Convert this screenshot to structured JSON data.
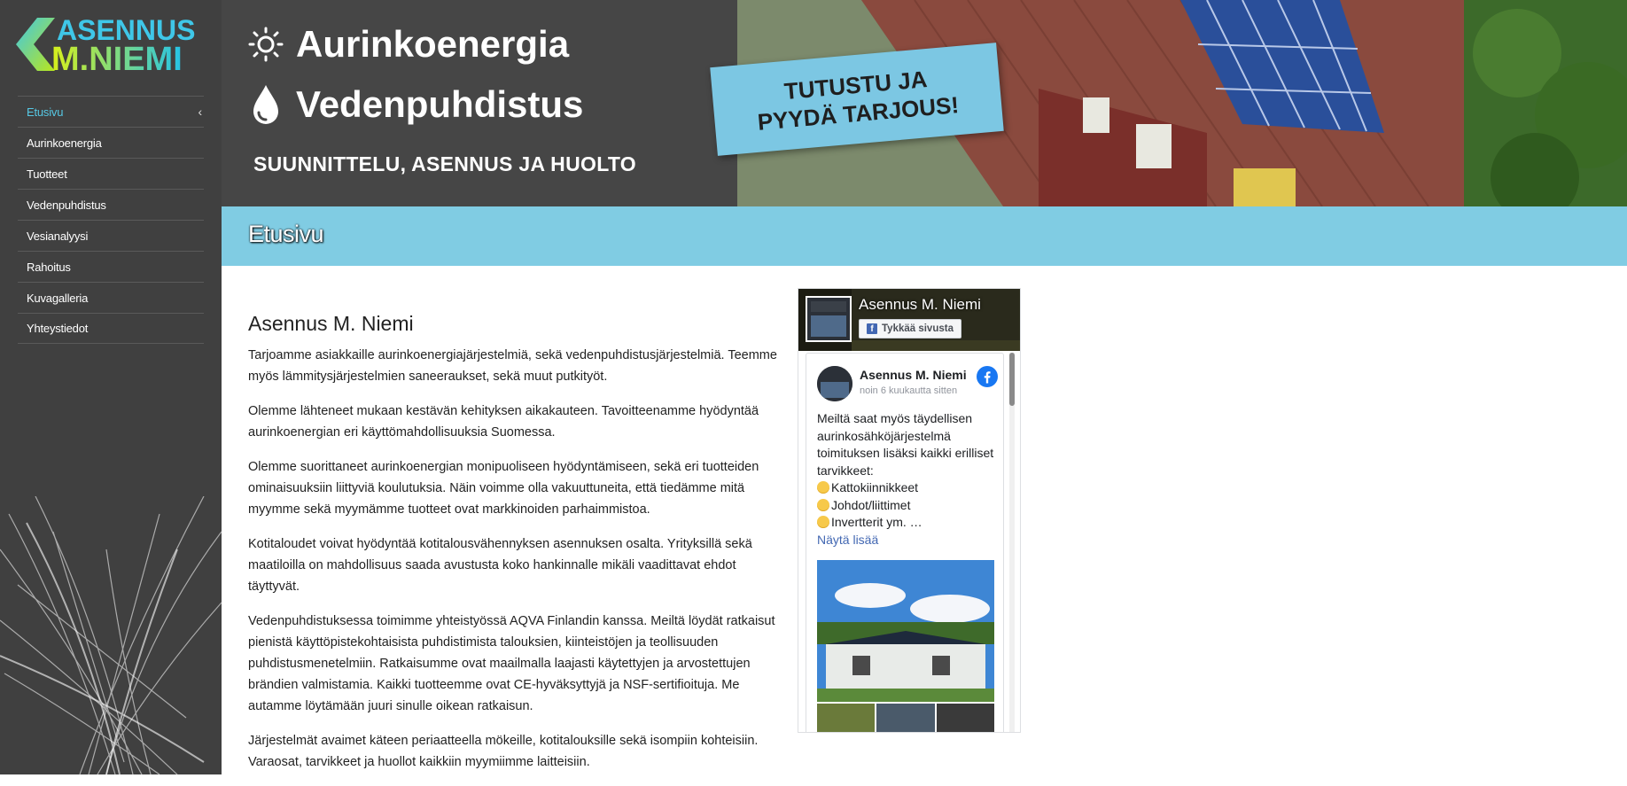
{
  "logo": {
    "line1": "ASENNUS",
    "line2": "M.NIEMI"
  },
  "nav": {
    "items": [
      {
        "label": "Etusivu",
        "active": true
      },
      {
        "label": "Aurinkoenergia"
      },
      {
        "label": "Tuotteet"
      },
      {
        "label": "Vedenpuhdistus"
      },
      {
        "label": "Vesianalyysi"
      },
      {
        "label": "Rahoitus"
      },
      {
        "label": "Kuvagalleria"
      },
      {
        "label": "Yhteystiedot"
      }
    ],
    "active_chevron": "‹"
  },
  "banner": {
    "line1": "Aurinkoenergia",
    "line2": "Vedenpuhdistus",
    "subtitle": "SUUNNITTELU, ASENNUS JA HUOLTO",
    "cta_line1": "TUTUSTU JA",
    "cta_line2": "PYYDÄ TARJOUS!",
    "icon1": "sun-icon",
    "icon2": "water-drop-icon"
  },
  "page": {
    "title": "Etusivu"
  },
  "content": {
    "heading": "Asennus M. Niemi",
    "paragraphs": [
      "Tarjoamme asiakkaille aurinkoenergiajärjestelmiä, sekä vedenpuhdistusjärjestelmiä. Teemme myös lämmitysjärjestelmien saneeraukset, sekä muut putkityöt.",
      "Olemme lähteneet mukaan kestävän kehityksen aikakauteen. Tavoitteenamme hyödyntää aurinkoenergian eri käyttömahdollisuuksia Suomessa.",
      "Olemme suorittaneet aurinkoenergian monipuoliseen hyödyntämiseen, sekä eri tuotteiden ominaisuuksiin liittyviä koulutuksia. Näin voimme olla vakuuttuneita, että tiedämme mitä myymme sekä myymämme tuotteet ovat markkinoiden parhaimmistoa.",
      "Kotitaloudet voivat hyödyntää kotitalousvähennyksen asennuksen osalta. Yrityksillä sekä maatiloilla on mahdollisuus saada avustusta koko hankinnalle mikäli vaadittavat ehdot täyttyvät.",
      "Vedenpuhdistuksessa toimimme yhteistyössä AQVA Finlandin kanssa. Meiltä löydät ratkaisut pienistä käyttöpistekohtaisista puhdistimista talouksien, kiinteistöjen ja teollisuuden puhdistusmenetelmiin. Ratkaisumme ovat maailmalla laajasti käytettyjen ja arvostettujen brändien valmistamia. Kaikki tuotteemme ovat CE-hyväksyttyjä ja NSF-sertifioituja. Me autamme löytämään juuri sinulle oikean ratkaisun.",
      "Järjestelmät avaimet käteen periaatteella mökeille, kotitalouksille sekä isompiin kohteisiin. Varaosat, tarvikkeet ja huollot kaikkiin myymiimme laitteisiin."
    ]
  },
  "facebook": {
    "page_name": "Asennus M. Niemi",
    "like_label": "Tykkää sivusta",
    "post_author": "Asennus M. Niemi",
    "post_time": "noin 6 kuukautta sitten",
    "post_text": "Meiltä saat myös täydellisen aurinkosähköjärjestelmä toimituksen lisäksi kaikki erilliset tarvikkeet:",
    "post_items": [
      "Kattokiinnikkeet",
      "Johdot/liittimet",
      "Invertterit ym. …"
    ],
    "see_more": "Näytä lisää"
  }
}
